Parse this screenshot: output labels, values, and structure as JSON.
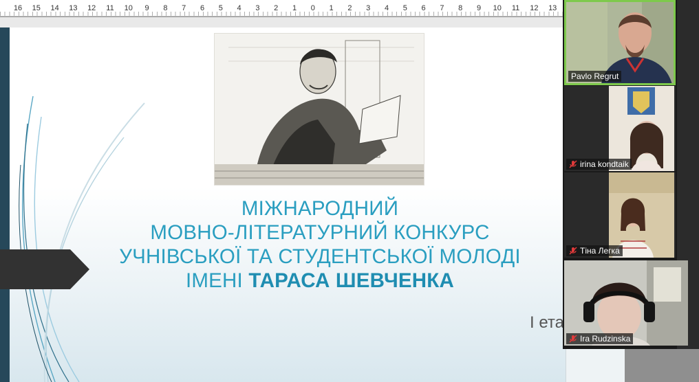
{
  "ruler": {
    "labels": [
      "16",
      "15",
      "14",
      "13",
      "12",
      "11",
      "10",
      "9",
      "8",
      "7",
      "6",
      "5",
      "4",
      "3",
      "2",
      "1",
      "0",
      "1",
      "2",
      "3",
      "4",
      "5",
      "6",
      "7",
      "8",
      "9",
      "10",
      "11",
      "12",
      "13"
    ]
  },
  "slide": {
    "title_line1": "МІЖНАРОДНИЙ",
    "title_line2": "МОВНО-ЛІТЕРАТУРНИЙ КОНКУРС",
    "title_line3": "УЧНІВСЬКОЇ ТА СТУДЕНТСЬКОЇ МОЛОДІ",
    "title_line4_prefix": "ІМЕНІ ",
    "title_line4_bold": "ТАРАСА ШЕВЧЕНКА",
    "stage_label": "І ета",
    "accent_color": "#2a9ec0",
    "strip_color": "#26485a"
  },
  "participants": [
    {
      "name": "Pavlo Regrut",
      "muted": false,
      "active": true
    },
    {
      "name": "irina kondtaik",
      "muted": true,
      "active": false
    },
    {
      "name": "Тіна Легка",
      "muted": true,
      "active": false
    },
    {
      "name": "Ira Rudzinska",
      "muted": true,
      "active": false
    }
  ]
}
